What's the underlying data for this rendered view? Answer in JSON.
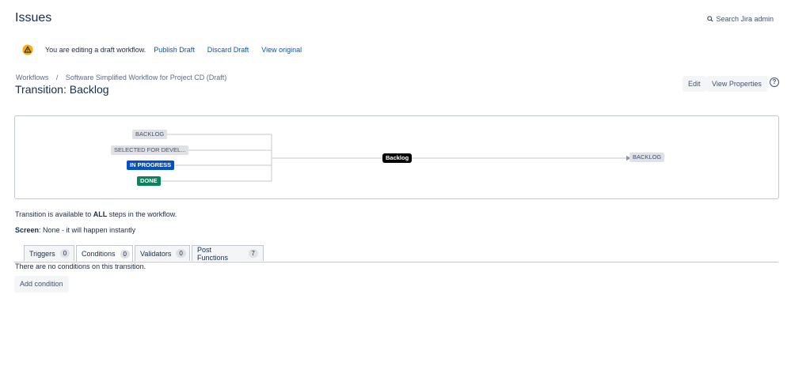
{
  "header": {
    "title": "Issues",
    "search_label": "Search Jira admin"
  },
  "notice": {
    "text": "You are editing a draft workflow.",
    "publish": "Publish Draft",
    "discard": "Discard Draft",
    "view_original": "View original"
  },
  "breadcrumb": {
    "root": "Workflows",
    "sep": "/",
    "current": "Software Simplified Workflow for Project CD (Draft)"
  },
  "transition_title": "Transition: Backlog",
  "actions": {
    "edit": "Edit",
    "view_properties": "View Properties",
    "help": "?"
  },
  "diagram": {
    "sources": [
      "BACKLOG",
      "SELECTED FOR DEVEL...",
      "IN PROGRESS",
      "DONE"
    ],
    "transition": "Backlog",
    "target": "BACKLOG",
    "colors": {
      "todo": "#dfe1e6",
      "inprogress": "#0052cc",
      "done": "#00875a"
    }
  },
  "availability": {
    "prefix": "Transition is available to ",
    "bold": "ALL",
    "suffix": " steps in the workflow."
  },
  "screen": {
    "label": "Screen",
    "value": ": None - it will happen instantly"
  },
  "tabs": [
    {
      "label": "Triggers",
      "count": "0"
    },
    {
      "label": "Conditions",
      "count": "0"
    },
    {
      "label": "Validators",
      "count": "0"
    },
    {
      "label": "Post Functions",
      "count": "7"
    }
  ],
  "conditions": {
    "empty_text": "There are no conditions on this transition.",
    "add_button": "Add condition"
  }
}
